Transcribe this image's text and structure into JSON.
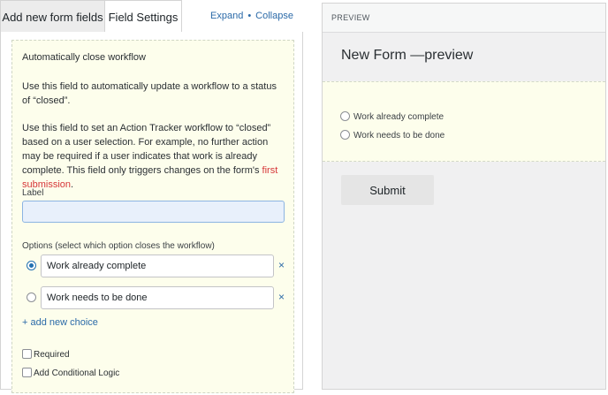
{
  "tabs": {
    "add_fields": "Add new form fields",
    "field_settings": "Field Settings",
    "expand": "Expand",
    "separator": "•",
    "collapse": "Collapse"
  },
  "field_settings": {
    "title": "Automatically close workflow",
    "description_1": "Use this field to automatically update a workflow to a status of “closed”.",
    "description_2_prefix": "Use this field to set an Action Tracker workflow to “closed” based on a user selection. For example, no further action may be required if a user indicates that work is already complete. This field only triggers changes on the form's ",
    "description_2_link": "first submission",
    "description_2_suffix": ".",
    "label_caption": "Label",
    "label_value": "",
    "options_caption": "Options (select which option closes the workflow)",
    "options": [
      {
        "value": "Work already complete",
        "selected": true
      },
      {
        "value": "Work needs to be done",
        "selected": false
      }
    ],
    "remove_symbol": "×",
    "add_choice": "+ add new choice",
    "required_label": "Required",
    "conditional_logic_label": "Add Conditional Logic"
  },
  "preview": {
    "header": "PREVIEW",
    "form_title": "New Form —preview",
    "options": [
      "Work already complete",
      "Work needs to be done"
    ],
    "submit_label": "Submit"
  },
  "colors": {
    "accent": "#2271b1",
    "link": "#2b6aa8",
    "highlight_link": "#d63638",
    "field_background": "#fdfeec"
  }
}
